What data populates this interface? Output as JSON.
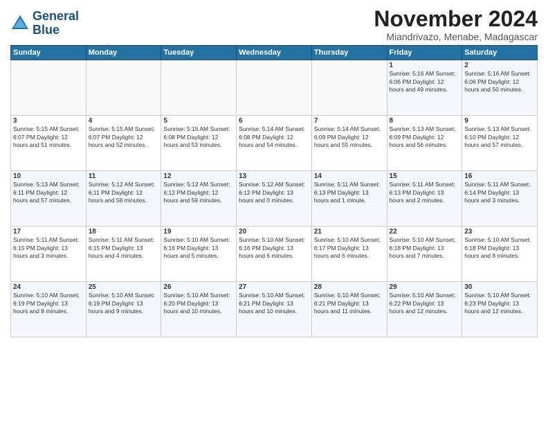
{
  "header": {
    "logo_line1": "General",
    "logo_line2": "Blue",
    "month_year": "November 2024",
    "location": "Miandrivazo, Menabe, Madagascar"
  },
  "weekdays": [
    "Sunday",
    "Monday",
    "Tuesday",
    "Wednesday",
    "Thursday",
    "Friday",
    "Saturday"
  ],
  "weeks": [
    [
      {
        "day": "",
        "info": ""
      },
      {
        "day": "",
        "info": ""
      },
      {
        "day": "",
        "info": ""
      },
      {
        "day": "",
        "info": ""
      },
      {
        "day": "",
        "info": ""
      },
      {
        "day": "1",
        "info": "Sunrise: 5:16 AM\nSunset: 6:06 PM\nDaylight: 12 hours\nand 49 minutes."
      },
      {
        "day": "2",
        "info": "Sunrise: 5:16 AM\nSunset: 6:06 PM\nDaylight: 12 hours\nand 50 minutes."
      }
    ],
    [
      {
        "day": "3",
        "info": "Sunrise: 5:15 AM\nSunset: 6:07 PM\nDaylight: 12 hours\nand 51 minutes."
      },
      {
        "day": "4",
        "info": "Sunrise: 5:15 AM\nSunset: 6:07 PM\nDaylight: 12 hours\nand 52 minutes."
      },
      {
        "day": "5",
        "info": "Sunrise: 5:15 AM\nSunset: 6:08 PM\nDaylight: 12 hours\nand 53 minutes."
      },
      {
        "day": "6",
        "info": "Sunrise: 5:14 AM\nSunset: 6:08 PM\nDaylight: 12 hours\nand 54 minutes."
      },
      {
        "day": "7",
        "info": "Sunrise: 5:14 AM\nSunset: 6:09 PM\nDaylight: 12 hours\nand 55 minutes."
      },
      {
        "day": "8",
        "info": "Sunrise: 5:13 AM\nSunset: 6:09 PM\nDaylight: 12 hours\nand 56 minutes."
      },
      {
        "day": "9",
        "info": "Sunrise: 5:13 AM\nSunset: 6:10 PM\nDaylight: 12 hours\nand 57 minutes."
      }
    ],
    [
      {
        "day": "10",
        "info": "Sunrise: 5:13 AM\nSunset: 6:11 PM\nDaylight: 12 hours\nand 57 minutes."
      },
      {
        "day": "11",
        "info": "Sunrise: 5:12 AM\nSunset: 6:11 PM\nDaylight: 12 hours\nand 58 minutes."
      },
      {
        "day": "12",
        "info": "Sunrise: 5:12 AM\nSunset: 6:12 PM\nDaylight: 12 hours\nand 59 minutes."
      },
      {
        "day": "13",
        "info": "Sunrise: 5:12 AM\nSunset: 6:12 PM\nDaylight: 13 hours\nand 0 minutes."
      },
      {
        "day": "14",
        "info": "Sunrise: 5:11 AM\nSunset: 6:13 PM\nDaylight: 13 hours\nand 1 minute."
      },
      {
        "day": "15",
        "info": "Sunrise: 5:11 AM\nSunset: 6:13 PM\nDaylight: 13 hours\nand 2 minutes."
      },
      {
        "day": "16",
        "info": "Sunrise: 5:11 AM\nSunset: 6:14 PM\nDaylight: 13 hours\nand 3 minutes."
      }
    ],
    [
      {
        "day": "17",
        "info": "Sunrise: 5:11 AM\nSunset: 6:15 PM\nDaylight: 13 hours\nand 3 minutes."
      },
      {
        "day": "18",
        "info": "Sunrise: 5:11 AM\nSunset: 6:15 PM\nDaylight: 13 hours\nand 4 minutes."
      },
      {
        "day": "19",
        "info": "Sunrise: 5:10 AM\nSunset: 6:16 PM\nDaylight: 13 hours\nand 5 minutes."
      },
      {
        "day": "20",
        "info": "Sunrise: 5:10 AM\nSunset: 6:16 PM\nDaylight: 13 hours\nand 6 minutes."
      },
      {
        "day": "21",
        "info": "Sunrise: 5:10 AM\nSunset: 6:17 PM\nDaylight: 13 hours\nand 6 minutes."
      },
      {
        "day": "22",
        "info": "Sunrise: 5:10 AM\nSunset: 6:18 PM\nDaylight: 13 hours\nand 7 minutes."
      },
      {
        "day": "23",
        "info": "Sunrise: 5:10 AM\nSunset: 6:18 PM\nDaylight: 13 hours\nand 8 minutes."
      }
    ],
    [
      {
        "day": "24",
        "info": "Sunrise: 5:10 AM\nSunset: 6:19 PM\nDaylight: 13 hours\nand 8 minutes."
      },
      {
        "day": "25",
        "info": "Sunrise: 5:10 AM\nSunset: 6:19 PM\nDaylight: 13 hours\nand 9 minutes."
      },
      {
        "day": "26",
        "info": "Sunrise: 5:10 AM\nSunset: 6:20 PM\nDaylight: 13 hours\nand 10 minutes."
      },
      {
        "day": "27",
        "info": "Sunrise: 5:10 AM\nSunset: 6:21 PM\nDaylight: 13 hours\nand 10 minutes."
      },
      {
        "day": "28",
        "info": "Sunrise: 5:10 AM\nSunset: 6:21 PM\nDaylight: 13 hours\nand 11 minutes."
      },
      {
        "day": "29",
        "info": "Sunrise: 5:10 AM\nSunset: 6:22 PM\nDaylight: 13 hours\nand 12 minutes."
      },
      {
        "day": "30",
        "info": "Sunrise: 5:10 AM\nSunset: 6:23 PM\nDaylight: 13 hours\nand 12 minutes."
      }
    ]
  ]
}
